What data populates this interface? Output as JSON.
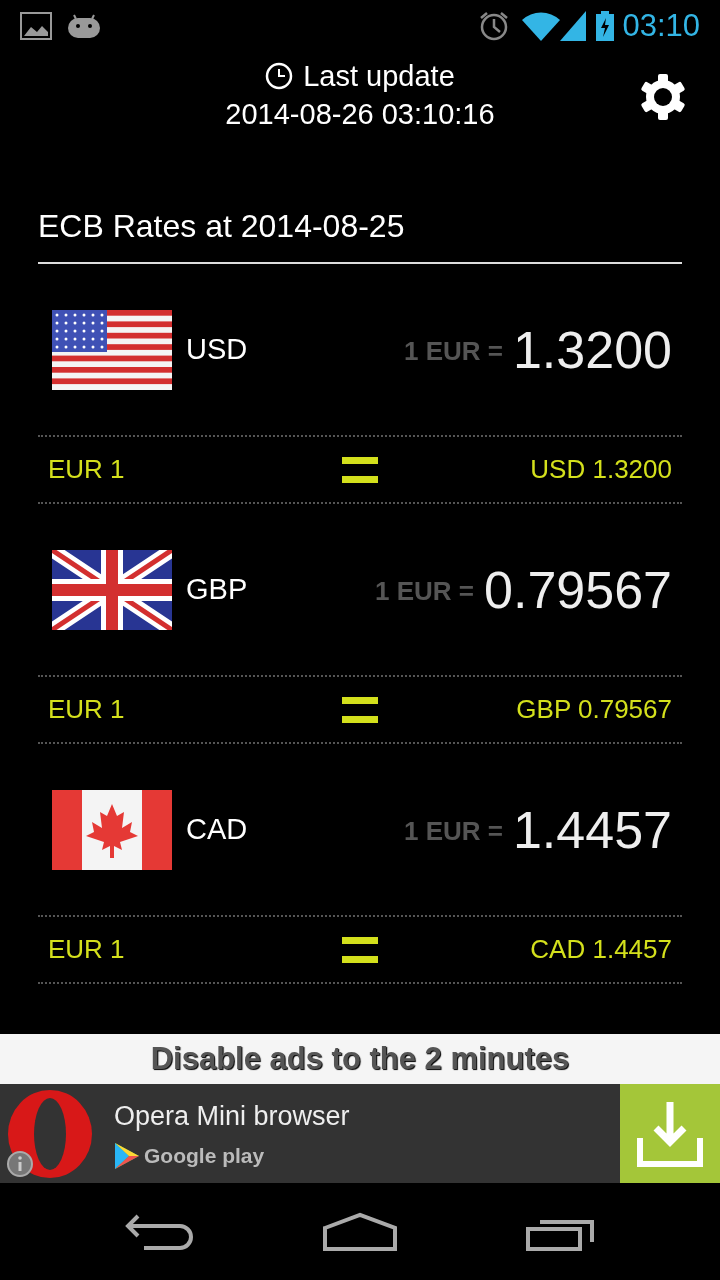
{
  "status_bar": {
    "time": "03:10"
  },
  "header": {
    "title": "Last update",
    "timestamp": "2014-08-26 03:10:16"
  },
  "section_title": "ECB Rates at 2014-08-25",
  "rates": [
    {
      "kind": "us",
      "code": "USD",
      "prefix": "1 EUR =",
      "rate": "1.3200",
      "base": "EUR 1",
      "converted": "USD 1.3200"
    },
    {
      "kind": "gb",
      "code": "GBP",
      "prefix": "1 EUR =",
      "rate": "0.79567",
      "base": "EUR 1",
      "converted": "GBP 0.79567"
    },
    {
      "kind": "ca",
      "code": "CAD",
      "prefix": "1 EUR =",
      "rate": "1.4457",
      "base": "EUR 1",
      "converted": "CAD 1.4457"
    }
  ],
  "ad_notice": "Disable ads to the 2 minutes",
  "ad": {
    "title": "Opera Mini browser",
    "store": "Google play"
  }
}
